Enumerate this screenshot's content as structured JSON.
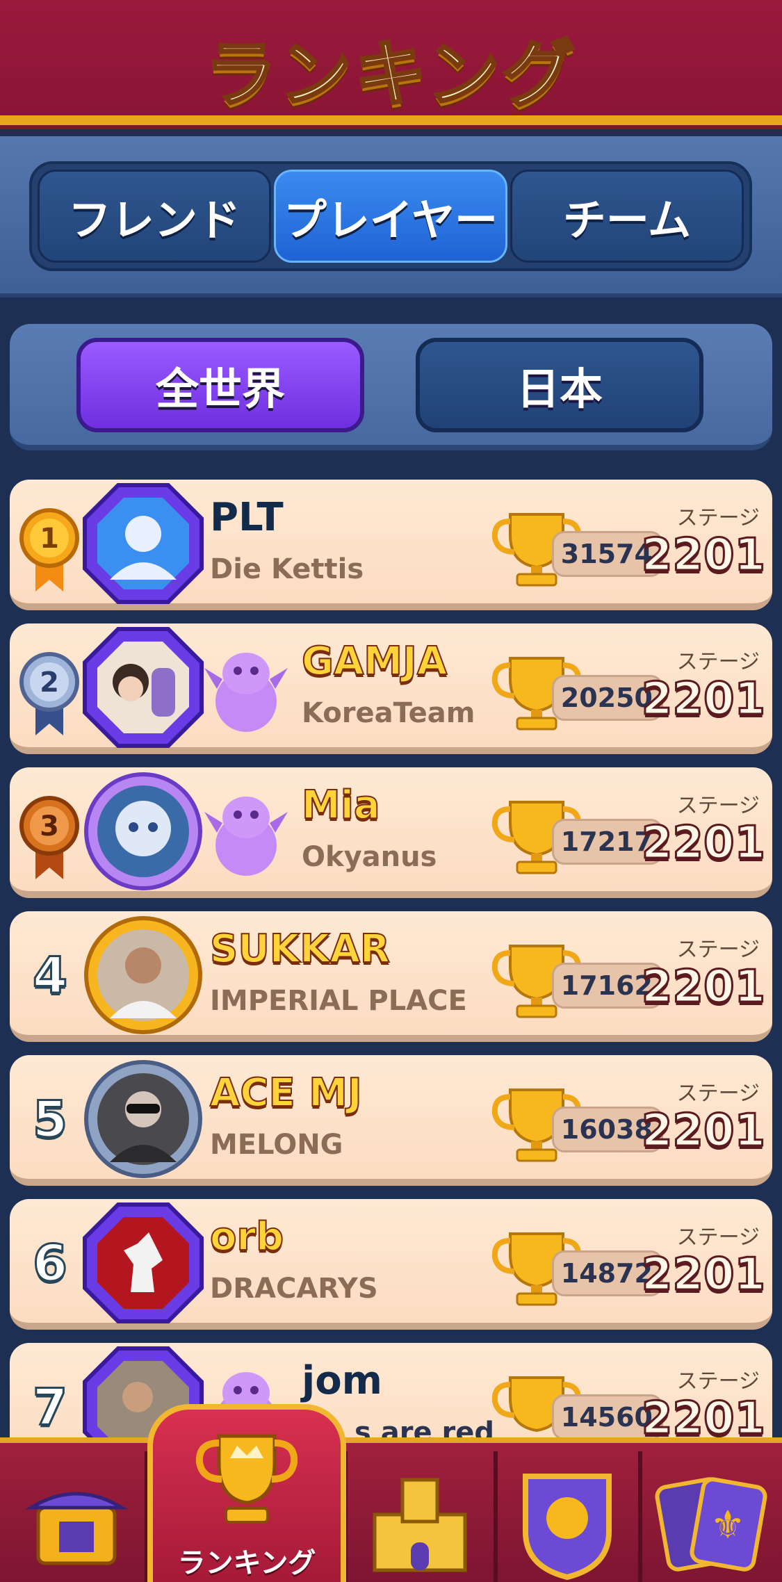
{
  "header": {
    "title": "ランキング"
  },
  "tabs": [
    {
      "label": "フレンド",
      "active": false
    },
    {
      "label": "プレイヤー",
      "active": true
    },
    {
      "label": "チーム",
      "active": false
    }
  ],
  "region": [
    {
      "label": "全世界",
      "active": true
    },
    {
      "label": "日本",
      "active": false
    }
  ],
  "stage_label": "ステージ",
  "rows": [
    {
      "rank": "1",
      "name": "PLT",
      "team": "Die Kettis",
      "trophies": "31574",
      "stage": "2201"
    },
    {
      "rank": "2",
      "name": "GAMJA",
      "team": "KoreaTeam",
      "trophies": "20250",
      "stage": "2201"
    },
    {
      "rank": "3",
      "name": "Mia",
      "team": "Okyanus",
      "trophies": "17217",
      "stage": "2201"
    },
    {
      "rank": "4",
      "name": "SUKKAR",
      "team": "IMPERIAL PLACE",
      "trophies": "17162",
      "stage": "2201"
    },
    {
      "rank": "5",
      "name": "ACE MJ",
      "team": "MELONG",
      "trophies": "16038",
      "stage": "2201"
    },
    {
      "rank": "6",
      "name": "orb",
      "team": "DRACARYS",
      "trophies": "14872",
      "stage": "2201"
    },
    {
      "rank": "7",
      "name": "jom",
      "team": "s are red",
      "trophies": "14560",
      "stage": "2201"
    }
  ],
  "bottom_nav": {
    "active_label": "ランキング"
  },
  "colors": {
    "header": "#8b1535",
    "gold": "#e9a81c",
    "tab_active": "#1f63d4",
    "region_active": "#6f2fe0",
    "row_bg": "#fbdcc1"
  }
}
